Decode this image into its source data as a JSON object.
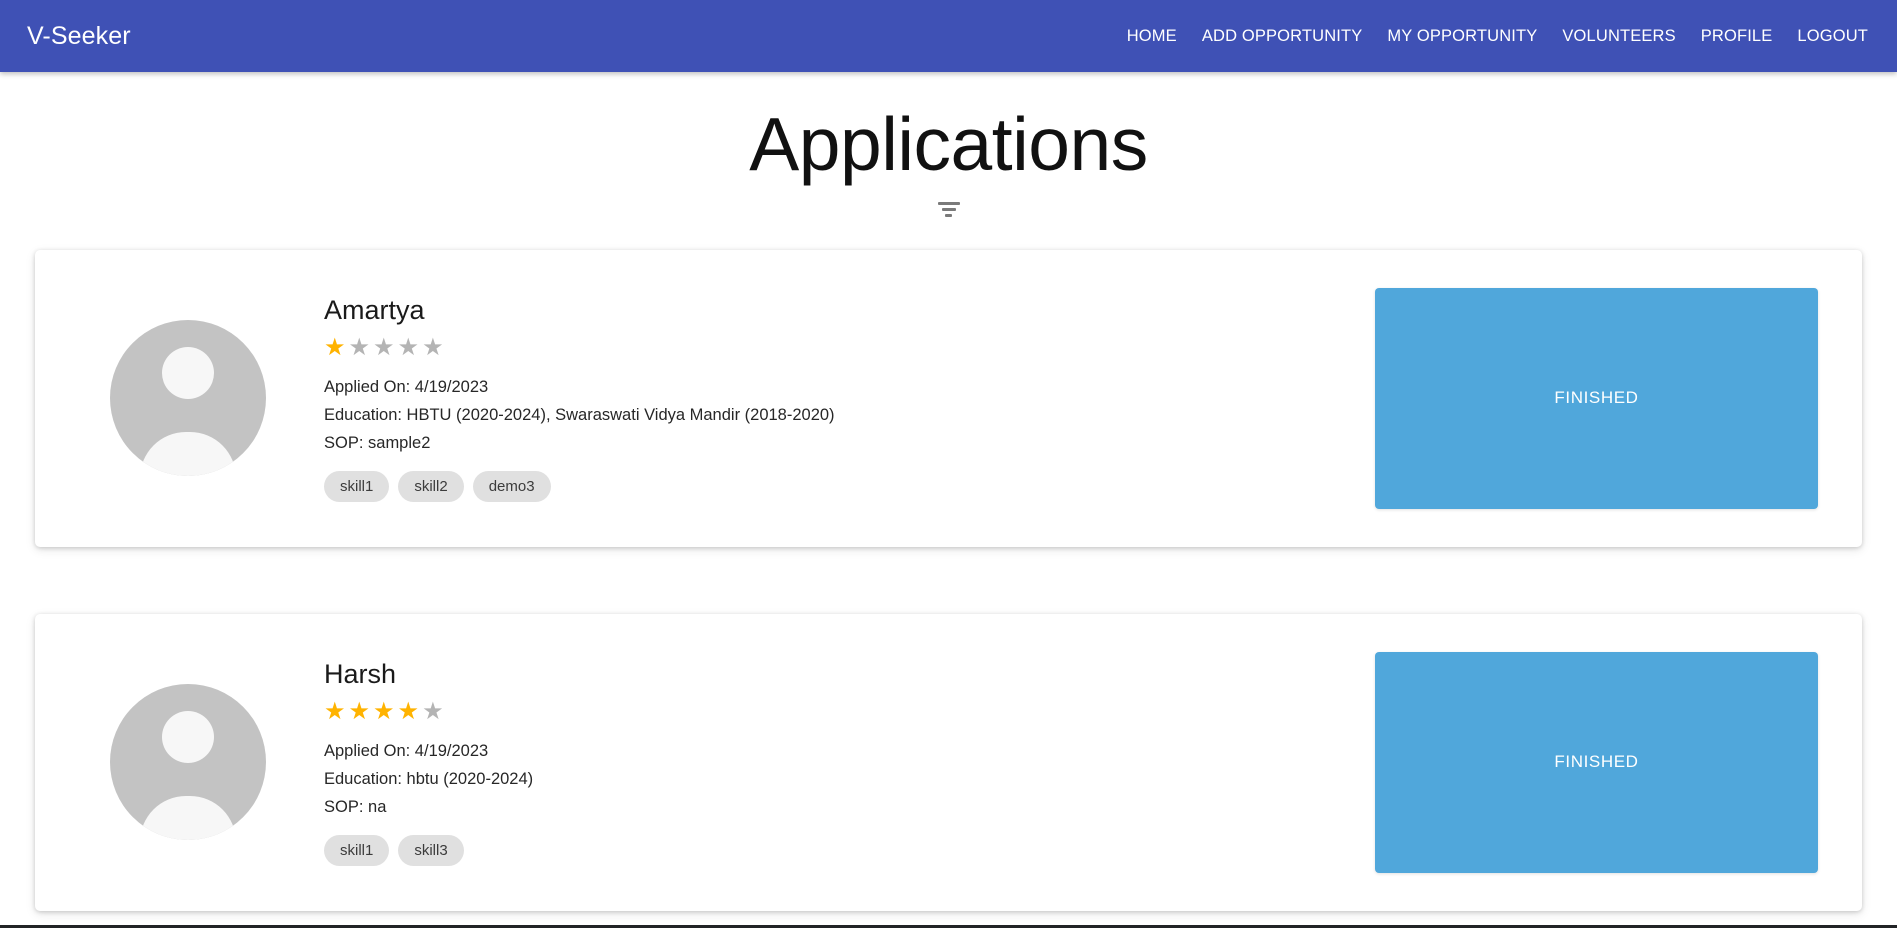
{
  "navbar": {
    "brand": "V-Seeker",
    "links": [
      {
        "label": "HOME",
        "name": "nav-link-home"
      },
      {
        "label": "ADD OPPORTUNITY",
        "name": "nav-link-add-opportunity"
      },
      {
        "label": "MY OPPORTUNITY",
        "name": "nav-link-my-opportunity"
      },
      {
        "label": "VOLUNTEERS",
        "name": "nav-link-volunteers"
      },
      {
        "label": "PROFILE",
        "name": "nav-link-profile"
      },
      {
        "label": "LOGOUT",
        "name": "nav-link-logout"
      }
    ],
    "background_color": "#3f51b5",
    "text_color": "#ffffff"
  },
  "page": {
    "title": "Applications",
    "filter_icon": "filter-sort-icon"
  },
  "colors": {
    "navbar": "#3f51b5",
    "status_button": "#50a7db",
    "star_filled": "#ffb300",
    "star_empty": "#b4b4b4",
    "chip_background": "#e0e0e0",
    "avatar_background": "#c3c3c3"
  },
  "applications": [
    {
      "name": "Amartya",
      "rating": 1,
      "rating_max": 5,
      "applied_on": "Applied On: 4/19/2023",
      "education": "Education: HBTU (2020-2024), Swaraswati Vidya Mandir (2018-2020)",
      "sop": "SOP: sample2",
      "skills": [
        "skill1",
        "skill2",
        "demo3"
      ],
      "status_label": "FINISHED",
      "avatar": "default-user-avatar"
    },
    {
      "name": "Harsh",
      "rating": 4,
      "rating_max": 5,
      "applied_on": "Applied On: 4/19/2023",
      "education": "Education: hbtu (2020-2024)",
      "sop": "SOP: na",
      "skills": [
        "skill1",
        "skill3"
      ],
      "status_label": "FINISHED",
      "avatar": "default-user-avatar"
    }
  ]
}
